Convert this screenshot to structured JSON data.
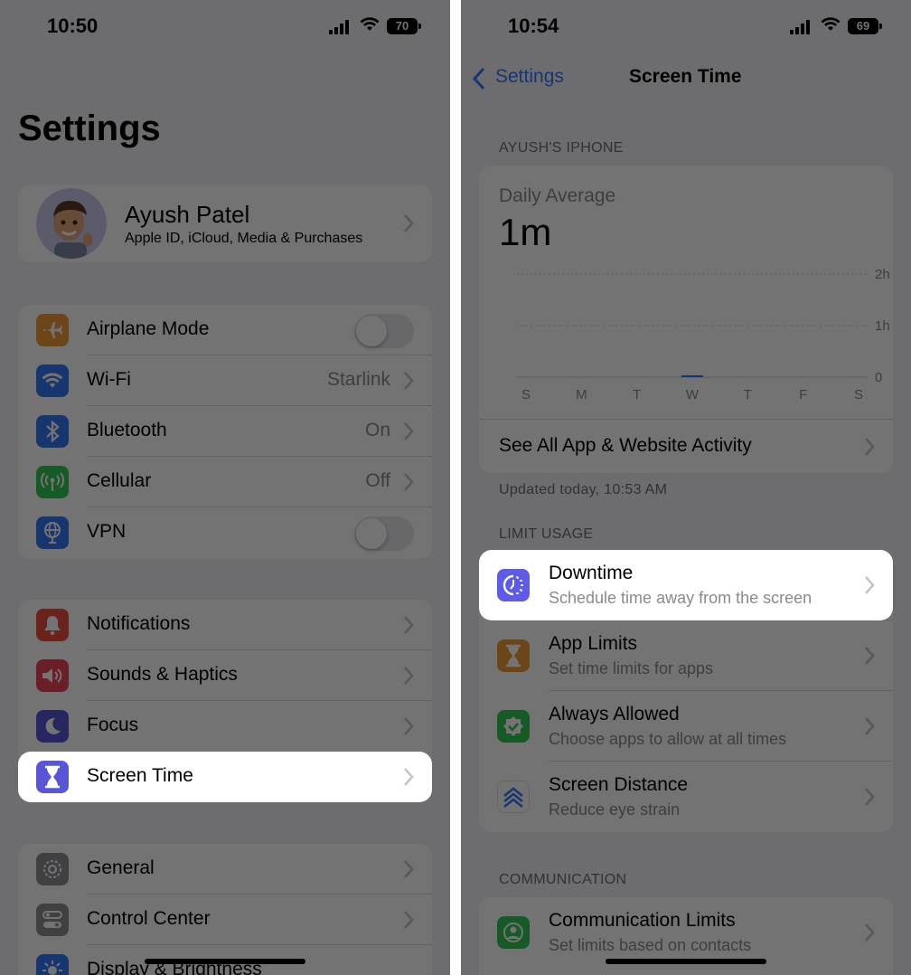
{
  "left": {
    "status": {
      "time": "10:50",
      "battery": "70"
    },
    "page_title": "Settings",
    "profile": {
      "name": "Ayush Patel",
      "subtitle": "Apple ID, iCloud, Media & Purchases"
    },
    "connectivity": [
      {
        "label": "Airplane Mode",
        "icon": "airplane-icon",
        "color": "#f09a37",
        "toggle": false
      },
      {
        "label": "Wi-Fi",
        "icon": "wifi-icon",
        "color": "#3478f6",
        "value": "Starlink"
      },
      {
        "label": "Bluetooth",
        "icon": "bluetooth-icon",
        "color": "#3478f6",
        "value": "On"
      },
      {
        "label": "Cellular",
        "icon": "antenna-icon",
        "color": "#33c759",
        "value": "Off"
      },
      {
        "label": "VPN",
        "icon": "globe-icon",
        "color": "#3478f6",
        "toggle": false
      }
    ],
    "notifications_group": [
      {
        "label": "Notifications",
        "icon": "bell-icon",
        "color": "#eb4e3d"
      },
      {
        "label": "Sounds & Haptics",
        "icon": "speaker-icon",
        "color": "#eb445a"
      },
      {
        "label": "Focus",
        "icon": "moon-icon",
        "color": "#5856d6"
      },
      {
        "label": "Screen Time",
        "icon": "hourglass-icon",
        "color": "#5856d6",
        "highlighted": true
      }
    ],
    "general_group": [
      {
        "label": "General",
        "icon": "gear-icon",
        "color": "#8e8e93"
      },
      {
        "label": "Control Center",
        "icon": "switches-icon",
        "color": "#8e8e93"
      },
      {
        "label": "Display & Brightness",
        "icon": "sun-icon",
        "color": "#3478f6"
      }
    ]
  },
  "right": {
    "status": {
      "time": "10:54",
      "battery": "69"
    },
    "nav": {
      "back": "Settings",
      "title": "Screen Time"
    },
    "device_header": "AYUSH'S IPHONE",
    "daily": {
      "label": "Daily Average",
      "value": "1m"
    },
    "chart_data": {
      "type": "bar",
      "categories": [
        "S",
        "M",
        "T",
        "W",
        "T",
        "F",
        "S"
      ],
      "values": [
        0,
        0,
        0,
        1,
        0,
        0,
        0
      ],
      "y_ticks": [
        "2h",
        "1h",
        "0"
      ]
    },
    "see_all": "See All App & Website Activity",
    "updated": "Updated today, 10:53 AM",
    "limit_header": "LIMIT USAGE",
    "limit_items": [
      {
        "label": "Downtime",
        "sub": "Schedule time away from the screen",
        "icon": "downtime-icon",
        "color": "#5e5ce6",
        "highlighted": true
      },
      {
        "label": "App Limits",
        "sub": "Set time limits for apps",
        "icon": "hourglass-icon",
        "color": "#f09a37"
      },
      {
        "label": "Always Allowed",
        "sub": "Choose apps to allow at all times",
        "icon": "checkmark-badge-icon",
        "color": "#33c759"
      },
      {
        "label": "Screen Distance",
        "sub": "Reduce eye strain",
        "icon": "chevrons-up-icon",
        "color": "#3478f6"
      }
    ],
    "comm_header": "COMMUNICATION",
    "comm_items": [
      {
        "label": "Communication Limits",
        "sub": "Set limits based on contacts",
        "icon": "person-circle-icon",
        "color": "#33c759"
      }
    ]
  }
}
